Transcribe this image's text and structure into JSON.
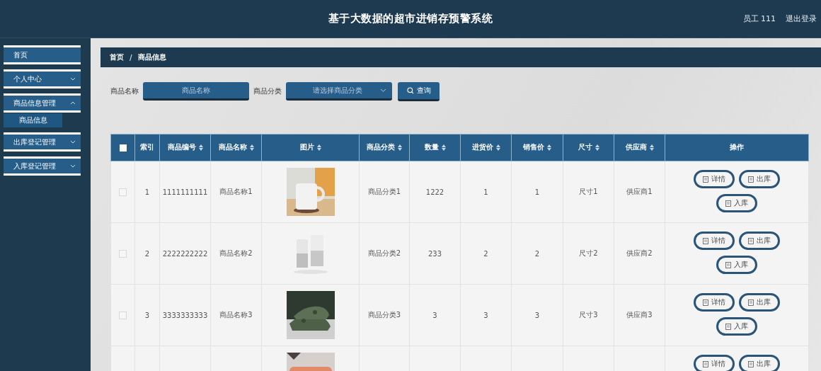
{
  "header": {
    "title": "基于大数据的超市进销存预警系统",
    "user": "员工 111",
    "logout": "退出登录"
  },
  "sidebar": {
    "items": [
      {
        "label": "首页"
      },
      {
        "label": "个人中心",
        "expanded": false
      },
      {
        "label": "商品信息管理",
        "expanded": true,
        "children": [
          {
            "label": "商品信息"
          }
        ]
      },
      {
        "label": "出库登记管理",
        "expanded": false
      },
      {
        "label": "入库登记管理",
        "expanded": false
      }
    ]
  },
  "breadcrumb": {
    "separator": "/",
    "items": [
      "首页",
      "商品信息"
    ]
  },
  "search": {
    "name_label": "商品名称",
    "name_placeholder": "商品名称",
    "category_label": "商品分类",
    "category_placeholder": "请选择商品分类",
    "button": "查询"
  },
  "table": {
    "columns": [
      "索引",
      "商品编号",
      "商品名称",
      "图片",
      "商品分类",
      "数量",
      "进货价",
      "销售价",
      "尺寸",
      "供应商",
      "操作"
    ],
    "select_all_checked": false,
    "rows": [
      {
        "checked": false,
        "index": "1",
        "code": "1111111111",
        "name": "商品名称1",
        "picture": {
          "kind": "picture"
        },
        "category": "商品分类1",
        "qty": "1222",
        "cost": "1",
        "price": "1",
        "size": "尺寸1",
        "supplier": "供应商1",
        "actions": [
          "详情",
          "出库",
          "入库"
        ]
      },
      {
        "checked": false,
        "index": "2",
        "code": "2222222222",
        "name": "商品名称2",
        "picture": {
          "kind": "picture"
        },
        "category": "商品分类2",
        "qty": "233",
        "cost": "2",
        "price": "2",
        "size": "尺寸2",
        "supplier": "供应商2",
        "actions": [
          "详情",
          "出库",
          "入库"
        ]
      },
      {
        "checked": false,
        "index": "3",
        "code": "3333333333",
        "name": "商品名称3",
        "picture": {
          "kind": "picture"
        },
        "category": "商品分类3",
        "qty": "3",
        "cost": "3",
        "price": "3",
        "size": "尺寸3",
        "supplier": "供应商3",
        "actions": [
          "详情",
          "出库",
          "入库"
        ]
      },
      {
        "picture": {
          "kind": "picture"
        },
        "actions": [
          "详情",
          "出库"
        ]
      }
    ]
  }
}
